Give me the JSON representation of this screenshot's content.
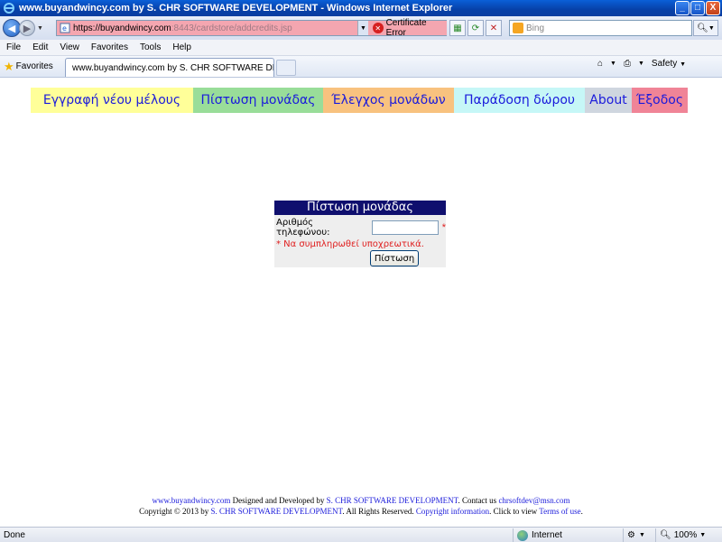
{
  "window": {
    "title": "www.buyandwincy.com by S. CHR SOFTWARE DEVELOPMENT - Windows Internet Explorer",
    "buttons": {
      "minimize": "_",
      "maximize": "□",
      "close": "X"
    }
  },
  "address": {
    "url_host": "https://buyandwincy.com",
    "url_rest": ":8443/cardstore/addcredits.jsp",
    "certificate": "Certificate Error",
    "search_placeholder": "Bing"
  },
  "menu": [
    "File",
    "Edit",
    "View",
    "Favorites",
    "Tools",
    "Help"
  ],
  "favbar": {
    "favorites": "Favorites",
    "tab_title": "www.buyandwincy.com by S. CHR SOFTWARE DEVEL...",
    "safety": "Safety"
  },
  "nav": [
    "Εγγραφή νέου μέλους",
    "Πίστωση μονάδας",
    "Έλεγχος μονάδων",
    "Παράδοση δώρου",
    "About",
    "Έξοδος"
  ],
  "form": {
    "header": "Πίστωση μονάδας",
    "phone_label": "Αριθμός τηλεφώνου:",
    "phone_value": "",
    "required_mark": "*",
    "error": "* Να συμπληρωθεί υποχρεωτικά.",
    "submit": "Πίστωση"
  },
  "footer": {
    "site": "www.buyandwincy.com",
    "designed": " Designed and Developed by ",
    "company": "S. CHR SOFTWARE DEVELOPMENT",
    "contact": ". Contact us ",
    "email": "chrsoftdev@msn.com",
    "copyright": "Copyright © 2013 by ",
    "company2": "S. CHR SOFTWARE DEVELOPMENT",
    "rights": ". All Rights Reserved. ",
    "copyinfo": "Copyright information",
    "clickview": ". Click to view ",
    "terms": "Terms of use",
    "end": "."
  },
  "status": {
    "text": "Done",
    "zone": "Internet",
    "zoom": "100%"
  },
  "colors": {
    "title_bar": "#0740a8",
    "address_error_bg": "#f4a6b0",
    "form_header": "#0f0f6e",
    "link": "#1b1bdb",
    "error": "#e02020"
  }
}
